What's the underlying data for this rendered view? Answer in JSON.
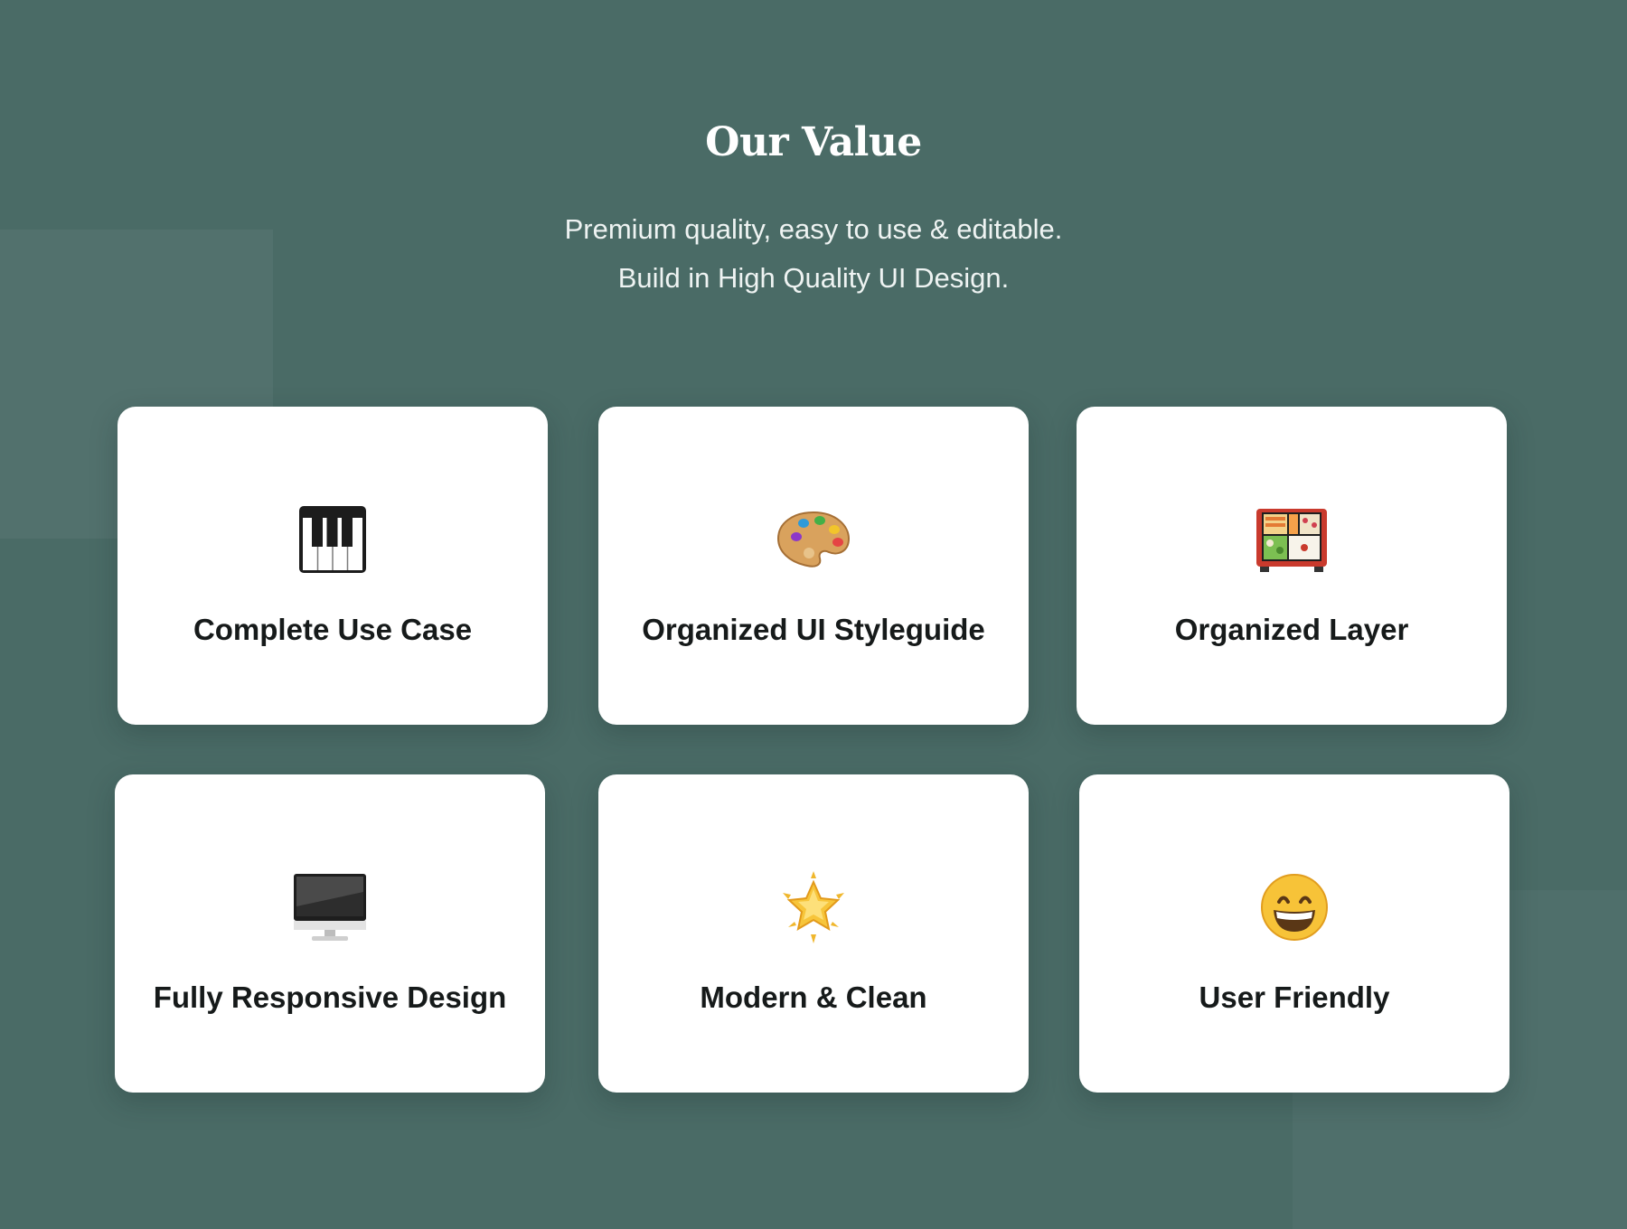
{
  "section": {
    "title": "Our Value",
    "subtitle_line1": "Premium quality, easy to use & editable.",
    "subtitle_line2": "Build in High Quality UI Design."
  },
  "colors": {
    "background": "#4a6b66",
    "card": "#ffffff",
    "text_dark": "#161a1a"
  },
  "cards": [
    {
      "label": "Complete Use Case",
      "icon": "piano-keys-icon"
    },
    {
      "label": "Organized UI Styleguide",
      "icon": "artist-palette-icon"
    },
    {
      "label": "Organized Layer",
      "icon": "bento-box-icon"
    },
    {
      "label": "Fully Responsive Design",
      "icon": "desktop-computer-icon"
    },
    {
      "label": "Modern & Clean",
      "icon": "glowing-star-icon"
    },
    {
      "label": "User Friendly",
      "icon": "grinning-face-icon"
    }
  ]
}
